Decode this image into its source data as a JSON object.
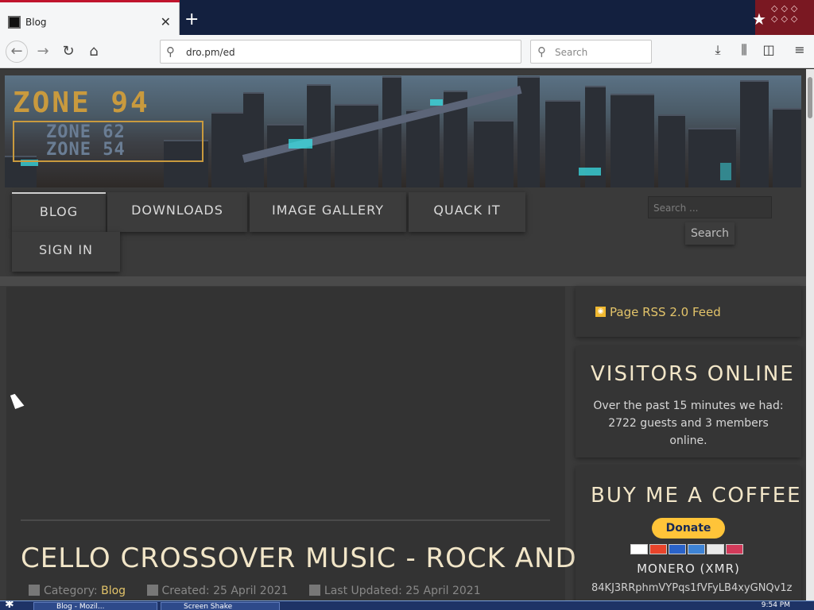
{
  "browser": {
    "tab_title": "Blog",
    "url": "dro.pm/ed",
    "search_placeholder": "Search"
  },
  "banner": {
    "logo_main": "ZONE 94",
    "logo_sub1": "ZONE 62",
    "logo_sub2": "ZONE 54"
  },
  "menu": {
    "items": [
      {
        "label": "BLOG"
      },
      {
        "label": "DOWNLOADS"
      },
      {
        "label": "IMAGE GALLERY"
      },
      {
        "label": "QUACK IT"
      },
      {
        "label": "SIGN IN"
      }
    ],
    "search_placeholder": "Search ...",
    "search_button": "Search"
  },
  "article": {
    "title": "CELLO CROSSOVER MUSIC - ROCK AND METAL",
    "category_label": "Category:",
    "category": "Blog",
    "created": "Created: 25 April 2021",
    "updated": "Last Updated: 25 April 2021"
  },
  "sidebar": {
    "rss": "Page RSS 2.0 Feed",
    "visitors_title": "VISITORS ONLINE",
    "visitors_text": "Over the past 15 minutes we had: 2722 guests and 3 members online.",
    "coffee_title": "BUY ME A COFFEE",
    "donate": "Donate",
    "monero_label": "MONERO (XMR)",
    "monero_address": "84KJ3RRphmVYPqs1fVFyLB4xyGNQv1z"
  },
  "taskbar": {
    "task1": "Blog - Mozil...",
    "task2": "Screen Shake",
    "clock": "9:54 PM"
  },
  "colors": {
    "accent_gold": "#e3c46a",
    "title_cream": "#f2e6c8",
    "paypal_yellow": "#ffc439"
  }
}
